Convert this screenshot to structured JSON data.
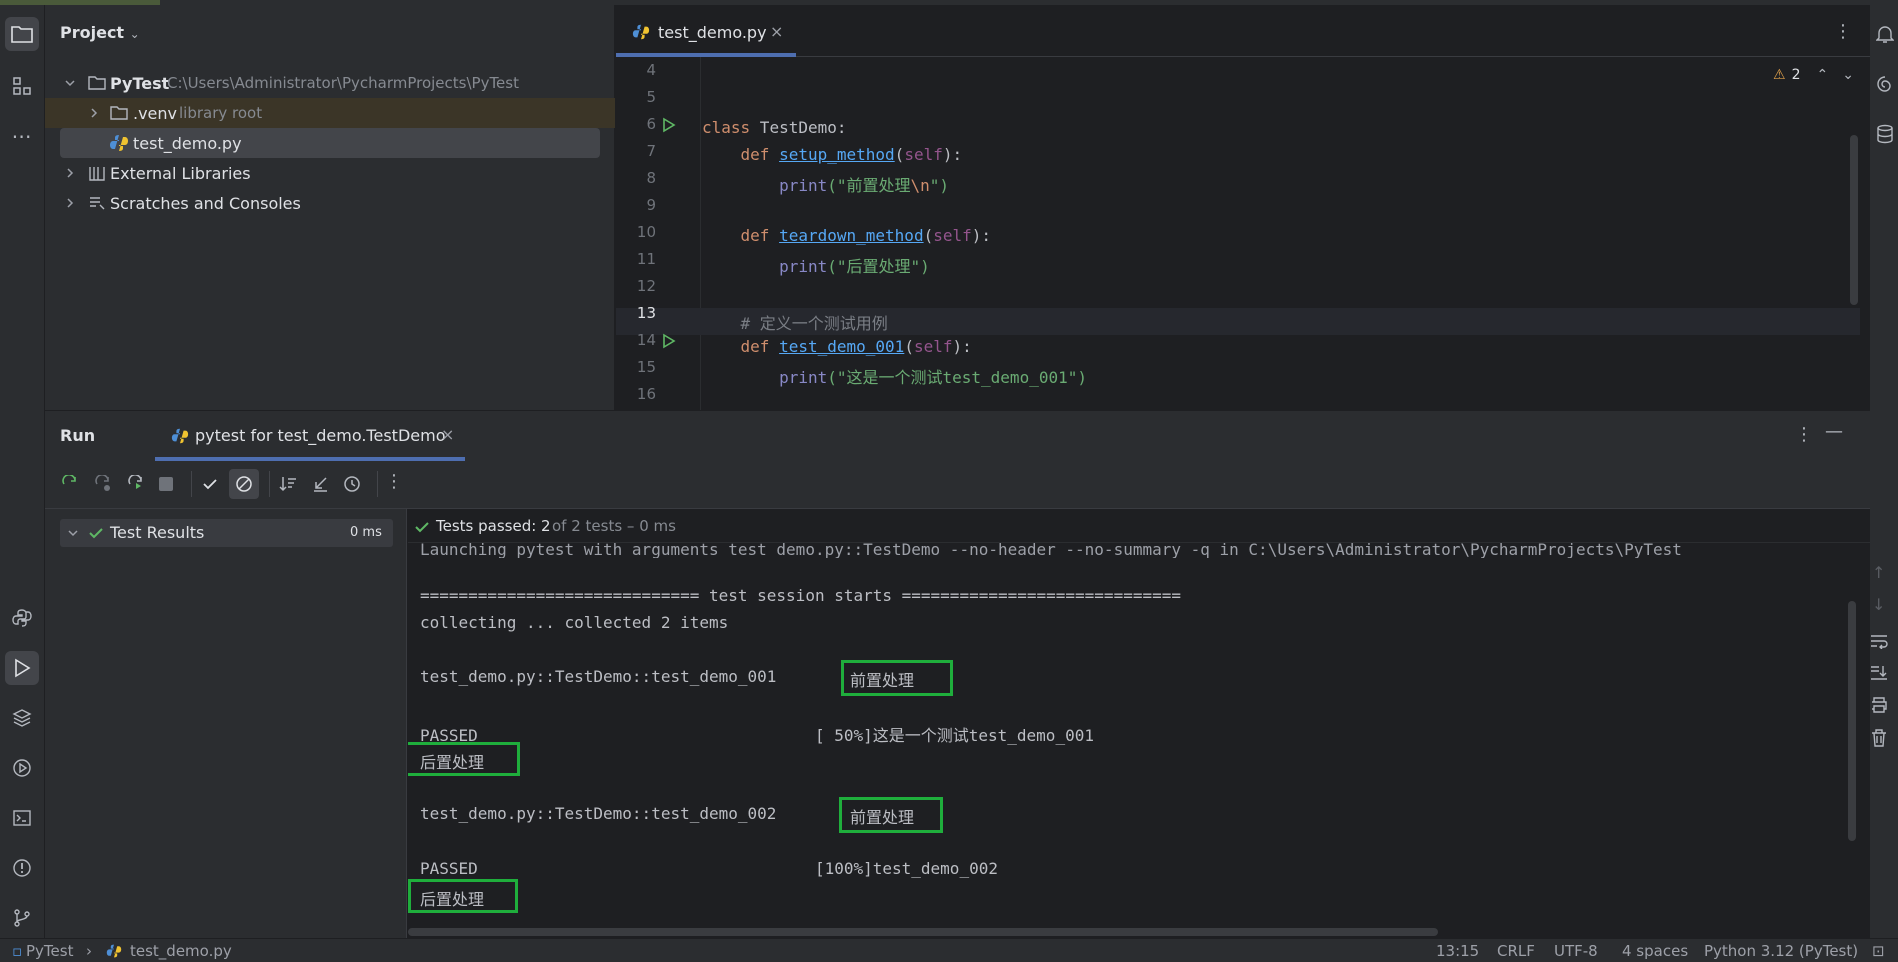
{
  "project": {
    "title": "Project",
    "root": {
      "name": "PyTest",
      "path": "C:\\Users\\Administrator\\PycharmProjects\\PyTest"
    },
    "venv": {
      "name": ".venv",
      "note": "library root"
    },
    "file": "test_demo.py",
    "external": "External Libraries",
    "scratches": "Scratches and Consoles"
  },
  "editor": {
    "tab": "test_demo.py",
    "warnings": "2",
    "lines": [
      {
        "n": "4"
      },
      {
        "n": "5"
      },
      {
        "n": "6",
        "t1": "class",
        "t2": " TestDemo:"
      },
      {
        "n": "7",
        "kw": "def",
        "fn": "setup_method",
        "self": "self",
        "tail": "):"
      },
      {
        "n": "8",
        "bi": "print",
        "s1": "(\"前置处理",
        "esc": "\\n",
        "s2": "\")"
      },
      {
        "n": "9"
      },
      {
        "n": "10",
        "kw": "def",
        "fn": "teardown_method",
        "self": "self",
        "tail": "):"
      },
      {
        "n": "11",
        "bi": "print",
        "s1": "(\"后置处理\")"
      },
      {
        "n": "12"
      },
      {
        "n": "13",
        "cm": "# 定义一个测试用例"
      },
      {
        "n": "14",
        "kw": "def",
        "fn": "test_demo_001",
        "self": "self",
        "tail": "):"
      },
      {
        "n": "15",
        "bi": "print",
        "s1": "(\"这是一个测试test_demo_001\")"
      },
      {
        "n": "16"
      }
    ]
  },
  "run": {
    "title": "Run",
    "tab": "pytest for test_demo.TestDemo",
    "results_label": "Test Results",
    "results_time": "0 ms",
    "passed": "Tests passed: 2",
    "passed_detail": "of 2 tests – 0 ms",
    "console": [
      "Launching pytest with arguments test_demo.py::TestDemo --no-header --no-summary -q in C:\\Users\\Administrator\\PycharmProjects\\PyTest",
      "============================= test session starts =============================",
      "collecting ... collected 2 items",
      "test_demo.py::TestDemo::test_demo_001",
      "前置处理",
      "PASSED                                   [ 50%]这是一个测试test_demo_001",
      "后置处理",
      "test_demo.py::TestDemo::test_demo_002",
      "前置处理",
      "PASSED                                   [100%]test_demo_002",
      "后置处理"
    ]
  },
  "status": {
    "crumb1": "PyTest",
    "crumb2": "test_demo.py",
    "pos": "13:15",
    "eol": "CRLF",
    "enc": "UTF-8",
    "indent": "4 spaces",
    "interp": "Python 3.12 (PyTest)"
  },
  "colors": {
    "accent": "#1fae3c",
    "highlight_box": "#1fae3c",
    "run_icon": "#5fb865"
  }
}
